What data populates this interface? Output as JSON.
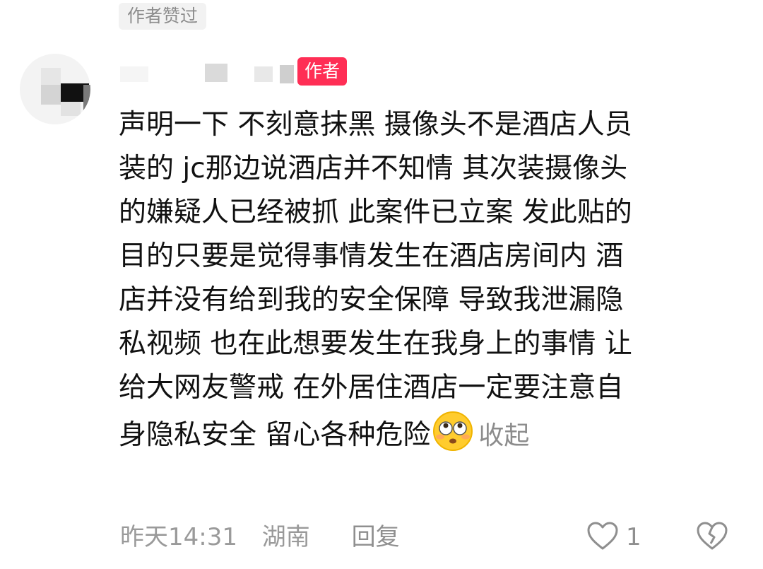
{
  "comment": {
    "liked_badge": "作者赞过",
    "author_tag": "作者",
    "lines": [
      "声明一下 不刻意抹黑 摄像头不是酒店人员",
      "装的 jc那边说酒店并不知情 其次装摄像头",
      "的嫌疑人已经被抓 此案件已立案 发此贴的",
      "目的只要是觉得事情发生在酒店房间内 酒",
      "店并没有给到我的安全保障 导致我泄漏隐",
      "私视频 也在此想要发生在我身上的事情 让",
      "给大网友警戒 在外居住酒店一定要注意自",
      "身隐私安全 留心各种危险"
    ],
    "emoji": "flushed-face-emoji",
    "collapse_label": "收起",
    "time": "昨天14:31",
    "location": "湖南",
    "reply_label": "回复",
    "like_count": "1"
  },
  "colors": {
    "author_tag_bg": "#ff2e55",
    "meta_text": "#9a9a9a",
    "body_text": "#111111"
  }
}
